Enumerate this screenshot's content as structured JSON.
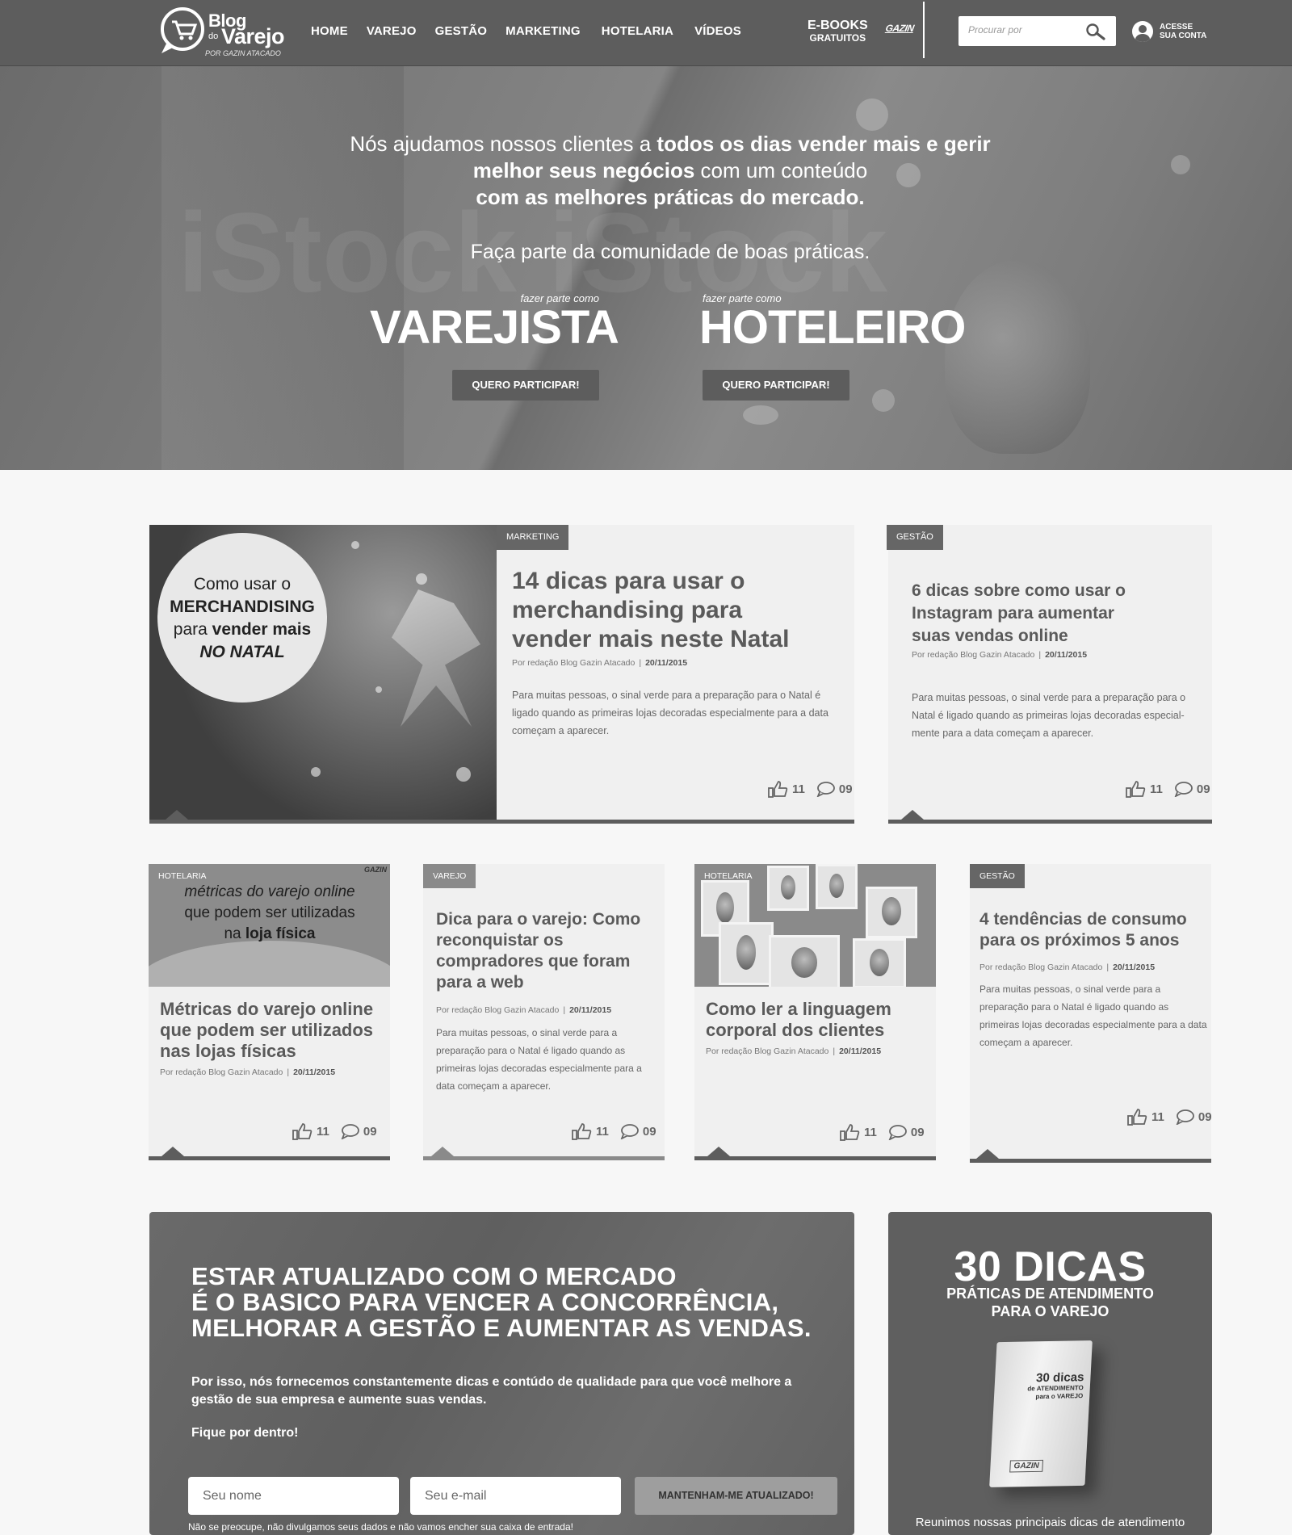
{
  "header": {
    "logo": {
      "blog": "Blog",
      "do": "do",
      "varejo": "Varejo",
      "sub": "POR GAZIN ATACADO"
    },
    "nav": [
      "HOME",
      "VAREJO",
      "GESTÃO",
      "MARKETING",
      "HOTELARIA",
      "VÍDEOS"
    ],
    "ebooks": {
      "line1": "E-BOOKS",
      "line2": "GRATUITOS"
    },
    "gazin": "GAZIN",
    "search": {
      "placeholder": "Procurar por",
      "value": ""
    },
    "account": {
      "line1": "ACESSE",
      "line2": "SUA CONTA"
    }
  },
  "hero": {
    "intro_a": "Nós ajudamos nossos clientes a ",
    "intro_b": "todos os dias vender mais e gerir melhor seus negócios",
    "intro_c": " com um conteúdo ",
    "intro_d": "com as melhores práticas do mercado.",
    "sub": "Faça parte da comunidade de boas práticas.",
    "watermark": "iStock iStock",
    "cta_varejista": {
      "pre": "fazer parte como",
      "big": "VAREJISTA",
      "button": "QUERO PARTICIPAR!"
    },
    "cta_hoteleiro": {
      "pre": "fazer parte como",
      "big": "HOTELEIRO",
      "button": "QUERO PARTICIPAR!"
    }
  },
  "featured": [
    {
      "tag": "MARKETING",
      "image_text": {
        "l1": "Como usar o",
        "l2": "MERCHANDISING",
        "l3a": "para ",
        "l3b": "vender mais",
        "l4": "NO NATAL"
      },
      "title": "14 dicas para usar o merchandising para vender mais neste Natal",
      "author": "Por redação Blog Gazin Atacado",
      "date": "20/11/2015",
      "excerpt": "Para muitas pessoas, o sinal verde para a preparação para o Natal é ligado quando as primeiras lojas decoradas especialmente para a data começam a aparecer.",
      "likes": "11",
      "comments": "09"
    },
    {
      "tag": "GESTÃO",
      "title": "6 dicas sobre como usar o Instagram para aumentar suas vendas online",
      "author": "Por redação Blog Gazin Atacado",
      "date": "20/11/2015",
      "excerpt": "Para muitas pessoas, o sinal verde para a preparação para o Natal é ligado quando as primeiras lojas decoradas especial- mente para a data começam a aparecer.",
      "likes": "11",
      "comments": "09"
    }
  ],
  "grid": [
    {
      "tag": "HOTELARIA",
      "image_text": {
        "l1": "métricas do varejo online",
        "l2": "que podem ser utilizadas",
        "l3a": "na ",
        "l3b": "loja física",
        "brand": "GAZIN"
      },
      "title": "Métricas do varejo online que podem ser utilizados nas lojas físicas",
      "author": "Por redação Blog Gazin Atacado",
      "date": "20/11/2015",
      "likes": "11",
      "comments": "09"
    },
    {
      "tag": "VAREJO",
      "title": "Dica para o varejo: Como reconquistar os compradores que foram para a web",
      "author": "Por redação Blog Gazin Atacado",
      "date": "20/11/2015",
      "excerpt": "Para muitas pessoas, o sinal verde para a preparação para o Natal é ligado quando as primeiras lojas decoradas especialmente para a data começam a aparecer.",
      "likes": "11",
      "comments": "09"
    },
    {
      "tag": "HOTELARIA",
      "title": "Como ler a linguagem corporal dos clientes",
      "author": "Por redação Blog Gazin Atacado",
      "date": "20/11/2015",
      "likes": "11",
      "comments": "09"
    },
    {
      "tag": "GESTÃO",
      "title": "4 tendências de consumo para os próximos 5 anos",
      "author": "Por redação Blog Gazin Atacado",
      "date": "20/11/2015",
      "excerpt": "Para muitas pessoas, o sinal verde para a preparação para o Natal é ligado quando as primeiras lojas decoradas especialmente para a data começam a aparecer.",
      "likes": "11",
      "comments": "09"
    }
  ],
  "newsletter": {
    "headline_1": "ESTAR ATUALIZADO COM O MERCADO",
    "headline_2": "É O BASICO PARA VENCER A CONCORRÊNCIA,",
    "headline_3": "MELHORAR A GESTÃO E AUMENTAR AS VENDAS.",
    "para": "Por isso, nós fornecemos constantemente dicas e contúdo de qualidade para que você melhore a gestão de sua empresa e aumente suas vendas.",
    "cta_text": "Fique por dentro!",
    "name_placeholder": "Seu nome",
    "email_placeholder": "Seu e-mail",
    "button": "MANTENHAM-ME ATUALIZADO!",
    "note": "Não se preocupe, não divulgamos seus dados e não vamos encher sua caixa de entrada!"
  },
  "ebook": {
    "title": "30 DICAS",
    "subtitle_1": "PRÁTICAS DE ATENDIMENTO",
    "subtitle_2": "PARA O VAREJO",
    "cover_1": "30 dicas",
    "cover_2": "de ATENDIMENTO",
    "cover_3": "para o VAREJO",
    "cover_brand": "GAZIN",
    "description": "Reunimos nossas principais dicas de atendimento"
  },
  "colors": {
    "header_bg": "#5d5d5d",
    "page_bg": "#f7f7f7",
    "card_bg": "#f0f0f0",
    "tag_bg": "#666666"
  }
}
